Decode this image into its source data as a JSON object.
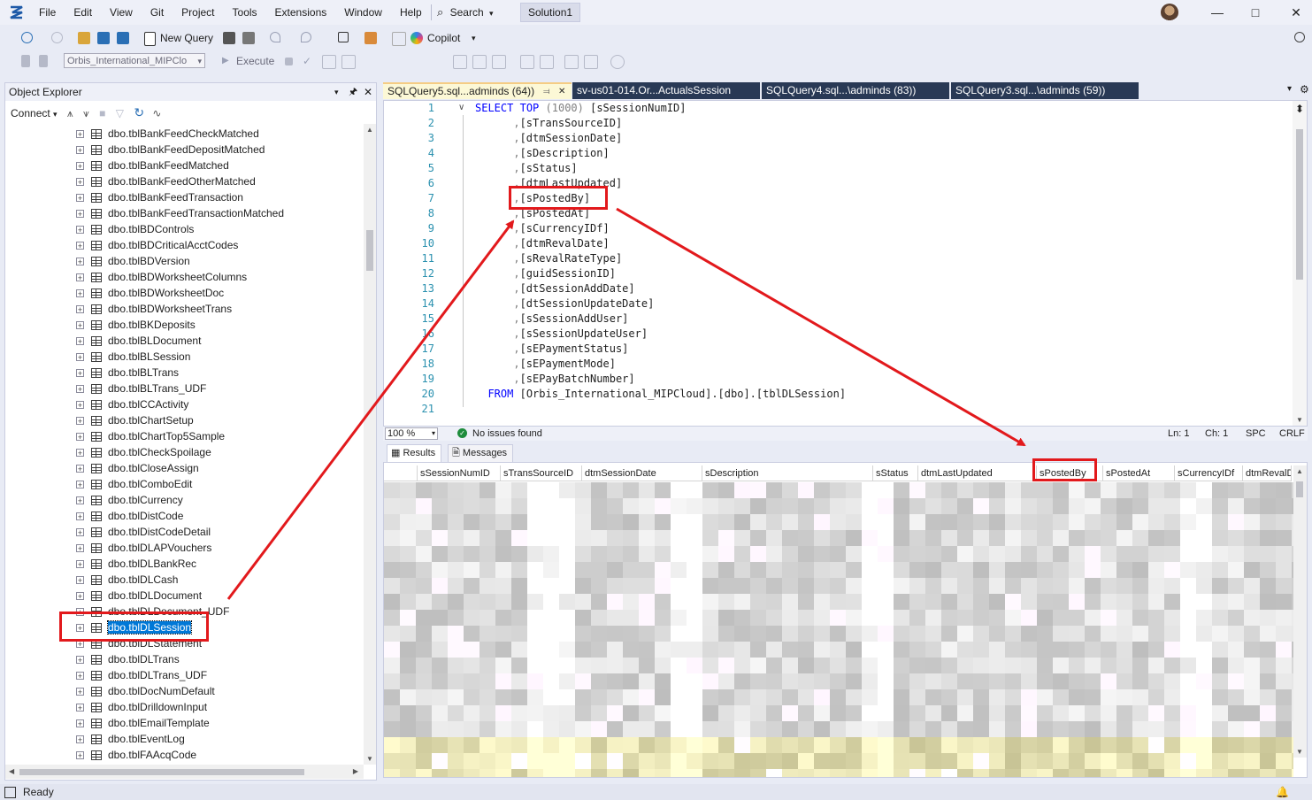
{
  "menu": [
    "File",
    "Edit",
    "View",
    "Git",
    "Project",
    "Tools",
    "Extensions",
    "Window",
    "Help"
  ],
  "search_label": "Search",
  "solution_name": "Solution1",
  "toolbar": {
    "new_query": "New Query",
    "copilot": "Copilot",
    "database": "Orbis_International_MIPClo",
    "execute": "Execute"
  },
  "object_explorer": {
    "title": "Object Explorer",
    "connect": "Connect",
    "items": [
      "dbo.tblBankFeedCheckMatched",
      "dbo.tblBankFeedDepositMatched",
      "dbo.tblBankFeedMatched",
      "dbo.tblBankFeedOtherMatched",
      "dbo.tblBankFeedTransaction",
      "dbo.tblBankFeedTransactionMatched",
      "dbo.tblBDControls",
      "dbo.tblBDCriticalAcctCodes",
      "dbo.tblBDVersion",
      "dbo.tblBDWorksheetColumns",
      "dbo.tblBDWorksheetDoc",
      "dbo.tblBDWorksheetTrans",
      "dbo.tblBKDeposits",
      "dbo.tblBLDocument",
      "dbo.tblBLSession",
      "dbo.tblBLTrans",
      "dbo.tblBLTrans_UDF",
      "dbo.tblCCActivity",
      "dbo.tblChartSetup",
      "dbo.tblChartTop5Sample",
      "dbo.tblCheckSpoilage",
      "dbo.tblCloseAssign",
      "dbo.tblComboEdit",
      "dbo.tblCurrency",
      "dbo.tblDistCode",
      "dbo.tblDistCodeDetail",
      "dbo.tblDLAPVouchers",
      "dbo.tblDLBankRec",
      "dbo.tblDLCash",
      "dbo.tblDLDocument",
      "dbo.tblDLDocument_UDF",
      "dbo.tblDLSession",
      "dbo.tblDLStatement",
      "dbo.tblDLTrans",
      "dbo.tblDLTrans_UDF",
      "dbo.tblDocNumDefault",
      "dbo.tblDrilldownInput",
      "dbo.tblEmailTemplate",
      "dbo.tblEventLog",
      "dbo.tblFAAcqCode"
    ],
    "selected": "dbo.tblDLSession"
  },
  "tabs": [
    "SQLQuery5.sql...adminds (64))",
    "sv-us01-014.Or...ActualsSession",
    "SQLQuery4.sql...\\adminds (83))",
    "SQLQuery3.sql...\\adminds (59))"
  ],
  "editor": {
    "line_numbers": [
      "1",
      "2",
      "3",
      "4",
      "5",
      "6",
      "7",
      "8",
      "9",
      "10",
      "11",
      "12",
      "13",
      "14",
      "15",
      "16",
      "17",
      "18",
      "19",
      "20",
      "21"
    ],
    "select_kw": "SELECT",
    "top_kw": "TOP",
    "top_n": "(1000)",
    "first_col": "[sSessionNumID]",
    "columns": [
      "[sTransSourceID]",
      "[dtmSessionDate]",
      "[sDescription]",
      "[sStatus]",
      "[dtmLastUpdated]",
      "[sPostedBy]",
      "[sPostedAt]",
      "[sCurrencyIDf]",
      "[dtmRevalDate]",
      "[sRevalRateType]",
      "[guidSessionID]",
      "[dtSessionAddDate]",
      "[dtSessionUpdateDate]",
      "[sSessionAddUser]",
      "[sSessionUpdateUser]",
      "[sEPaymentStatus]",
      "[sEPaymentMode]",
      "[sEPayBatchNumber]"
    ],
    "from_kw": "FROM",
    "from_target": "[Orbis_International_MIPCloud].[dbo].[tblDLSession]"
  },
  "editor_status": {
    "zoom": "100 %",
    "issues": "No issues found",
    "ln": "Ln: 1",
    "ch": "Ch: 1",
    "spc": "SPC",
    "crlf": "CRLF"
  },
  "result_tabs": [
    "Results",
    "Messages"
  ],
  "grid_columns": [
    "sSessionNumID",
    "sTransSourceID",
    "dtmSessionDate",
    "sDescription",
    "sStatus",
    "dtmLastUpdated",
    "sPostedBy",
    "sPostedAt",
    "sCurrencyIDf",
    "dtmRevalDa"
  ],
  "status_text": "Ready",
  "colors": {
    "accent": "#e2191c",
    "selection": "#0078d7",
    "keyword": "#0000ff",
    "line_number": "#2b91af"
  }
}
